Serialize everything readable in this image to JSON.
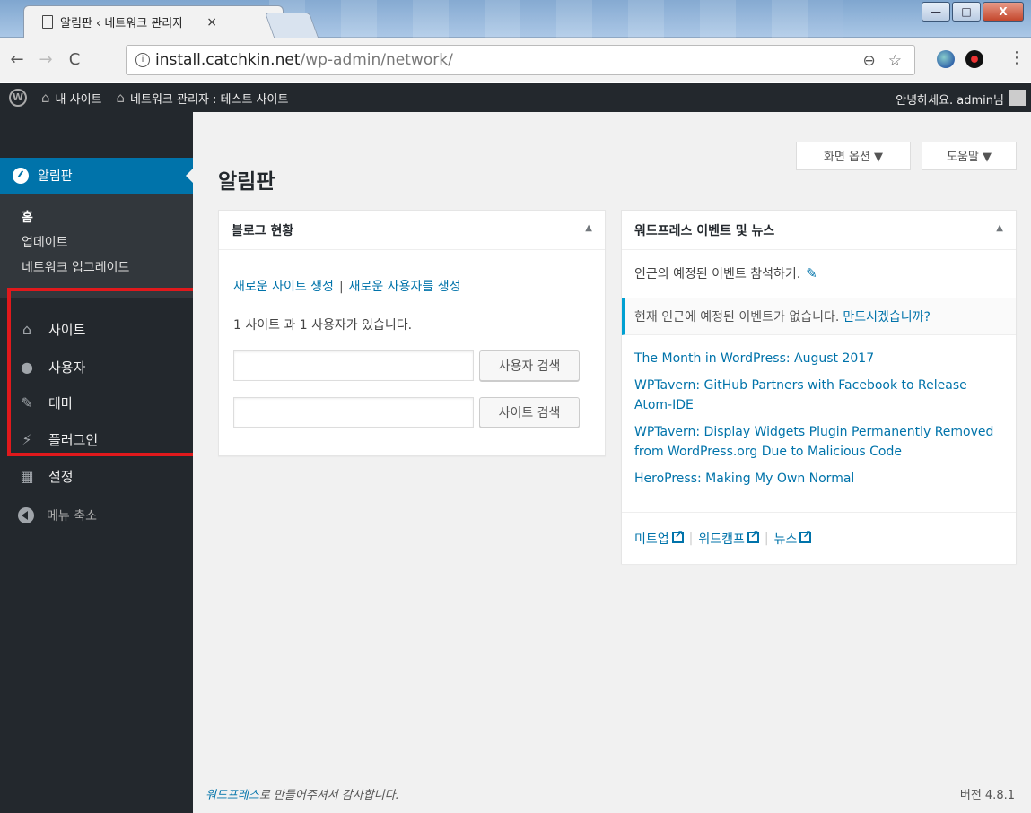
{
  "browser": {
    "tab_title": "알림판 ‹ 네트워크 관리자",
    "tab_close": "×",
    "url_host": "install.catchkin.net",
    "url_path": "/wp-admin/network/",
    "win_min": "—",
    "win_max": "□",
    "win_close": "X"
  },
  "adminbar": {
    "logo": "W",
    "my_sites": "내 사이트",
    "network_admin": "네트워크 관리자 : 테스트 사이트",
    "greeting": "안녕하세요. admin님"
  },
  "sidebar": {
    "current": "알림판",
    "submenu": [
      "홈",
      "업데이트",
      "네트워크 업그레이드"
    ],
    "items": [
      {
        "label": "사이트",
        "icon": "sites-icon"
      },
      {
        "label": "사용자",
        "icon": "users-icon"
      },
      {
        "label": "테마",
        "icon": "themes-icon"
      },
      {
        "label": "플러그인",
        "icon": "plugins-icon"
      },
      {
        "label": "설정",
        "icon": "settings-icon"
      }
    ],
    "collapse": "메뉴 축소"
  },
  "main": {
    "title": "알림판",
    "screen_options": "화면 옵션 ▼",
    "help": "도움말 ▼"
  },
  "blog_box": {
    "title": "블로그 현황",
    "link_new_site": "새로운 사이트 생성",
    "separator": "|",
    "link_new_user": "새로운 사용자를 생성",
    "count": "1 사이트 과 1 사용자가 있습니다.",
    "user_search_btn": "사용자 검색",
    "site_search_btn": "사이트 검색"
  },
  "news_box": {
    "title": "워드프레스 이벤트 및 뉴스",
    "intro": "인근의 예정된 이벤트 참석하기.",
    "none_text": "현재 인근에 예정된 이벤트가 없습니다.",
    "none_link": "만드시겠습니까?",
    "news": [
      "The Month in WordPress: August 2017",
      "WPTavern: GitHub Partners with Facebook to Release Atom-IDE",
      "WPTavern: Display Widgets Plugin Permanently Removed from WordPress.org Due to Malicious Code",
      "HeroPress: Making My Own Normal"
    ],
    "footer": [
      "미트업",
      "워드캠프",
      "뉴스"
    ],
    "pipe": "|"
  },
  "footer": {
    "wp_link": "워드프레스",
    "thanks": "로 만들어주셔서 감사합니다.",
    "version": "버전 4.8.1"
  },
  "colors": {
    "accent": "#0073aa",
    "adminbar_bg": "#23282d",
    "highlight": "#e0191c"
  }
}
